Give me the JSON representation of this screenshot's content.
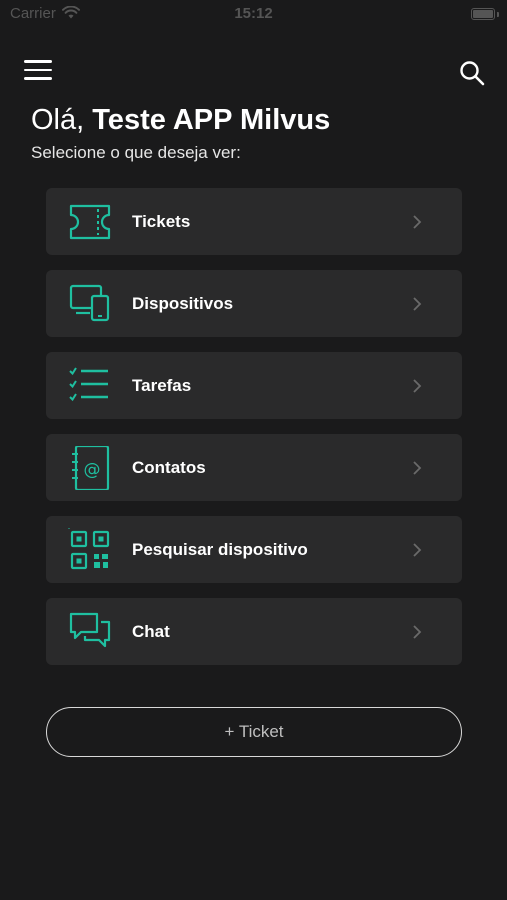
{
  "status_bar": {
    "carrier": "Carrier",
    "time": "15:12"
  },
  "header": {
    "greeting_prefix": "Olá,",
    "user_name": "Teste APP Milvus",
    "subtitle": "Selecione o que deseja ver:"
  },
  "menu": {
    "items": [
      {
        "label": "Tickets",
        "icon": "ticket-icon"
      },
      {
        "label": "Dispositivos",
        "icon": "devices-icon"
      },
      {
        "label": "Tarefas",
        "icon": "task-list-icon"
      },
      {
        "label": "Contatos",
        "icon": "contact-book-icon"
      },
      {
        "label": "Pesquisar dispositivo",
        "icon": "qr-code-icon"
      },
      {
        "label": "Chat",
        "icon": "chat-icon"
      }
    ]
  },
  "new_ticket_button": {
    "label": "+ Ticket"
  },
  "colors": {
    "background": "#1a1a1b",
    "card": "#2a2a2b",
    "accent": "#1fbfa0",
    "text": "#ffffff"
  }
}
